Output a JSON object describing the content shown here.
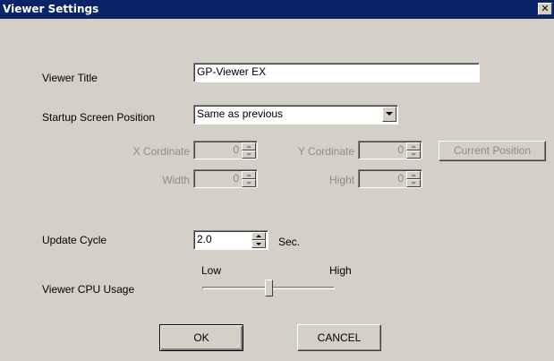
{
  "window": {
    "title": "Viewer Settings",
    "close_glyph": "✕",
    "close_icon": "close-icon"
  },
  "viewer_title": {
    "label": "Viewer Title",
    "value": "GP-Viewer EX"
  },
  "startup_position": {
    "label": "Startup Screen Position",
    "selected": "Same as previous"
  },
  "position_fields": {
    "x_label": "X Cordinate",
    "x_value": "0",
    "y_label": "Y Cordinate",
    "y_value": "0",
    "width_label": "Width",
    "width_value": "0",
    "height_label": "Hight",
    "height_value": "0",
    "current_position_button": "Current Position"
  },
  "update_cycle": {
    "label": "Update Cycle",
    "value": "2.0",
    "unit": "Sec."
  },
  "cpu_usage": {
    "label": "Viewer CPU Usage",
    "low_label": "Low",
    "high_label": "High",
    "level_fraction": 0.5
  },
  "buttons": {
    "ok": "OK",
    "cancel": "CANCEL"
  }
}
